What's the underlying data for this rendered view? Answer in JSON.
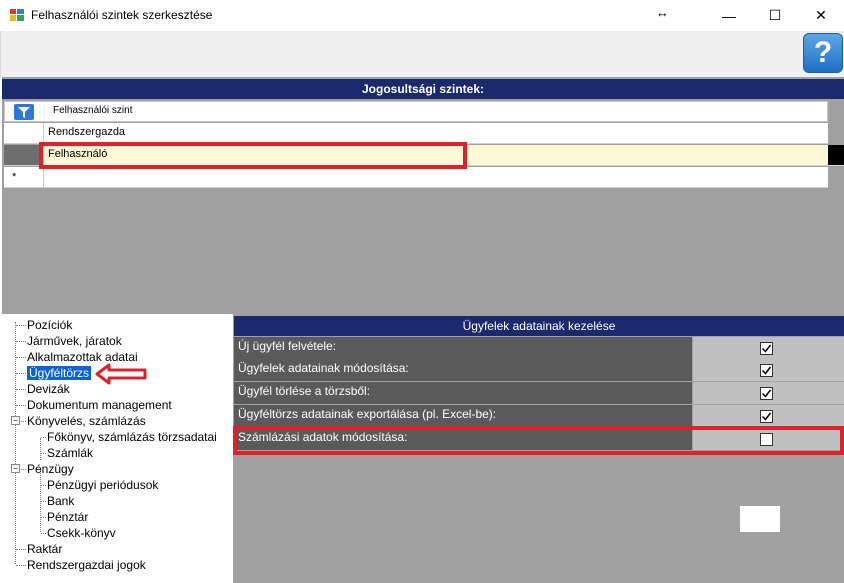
{
  "window": {
    "title": "Felhasználói szintek szerkesztése",
    "resize_glyph": "↔",
    "minimize_glyph": "—",
    "maximize_glyph": "☐",
    "close_glyph": "✕"
  },
  "toolbar": {
    "help_glyph": "?"
  },
  "levels_grid": {
    "title": "Jogosultsági szintek:",
    "column_header": "Felhasználói szint",
    "rows": [
      "Rendszergazda",
      "Felhasználó",
      ""
    ],
    "new_row_marker": "*"
  },
  "tree": {
    "items": [
      "Pozíciók",
      "Járművek, járatok",
      "Alkalmazottak adatai",
      "Ügyféltörzs",
      "Devizák",
      "Dokumentum management",
      "Könyvelés, számlázás",
      "Főkönyv, számlázás törzsadatai",
      "Számlák",
      "Pénzügy",
      "Pénzügyi periódusok",
      "Bank",
      "Pénztár",
      "Csekk-könyv",
      "Raktár",
      "Rendszergazdai jogok"
    ],
    "selected": "Ügyféltörzs"
  },
  "permissions": {
    "title": "Ügyfelek adatainak kezelése",
    "rows": [
      {
        "label": "Új ügyfél felvétele:",
        "checked": true
      },
      {
        "label": "Ügyfelek adatainak módosítása:",
        "checked": true
      },
      {
        "label": "Ügyfél törlése a törzsből:",
        "checked": true
      },
      {
        "label": "Ügyféltörzs adatainak exportálása (pl. Excel-be):",
        "checked": true
      },
      {
        "label": "Számlázási adatok módosítása:",
        "checked": false
      }
    ]
  },
  "colors": {
    "header_bg": "#1a2a6c",
    "highlight": "#e0202a",
    "selection_row": "#fff8d6",
    "tree_selected": "#0a64d6"
  }
}
